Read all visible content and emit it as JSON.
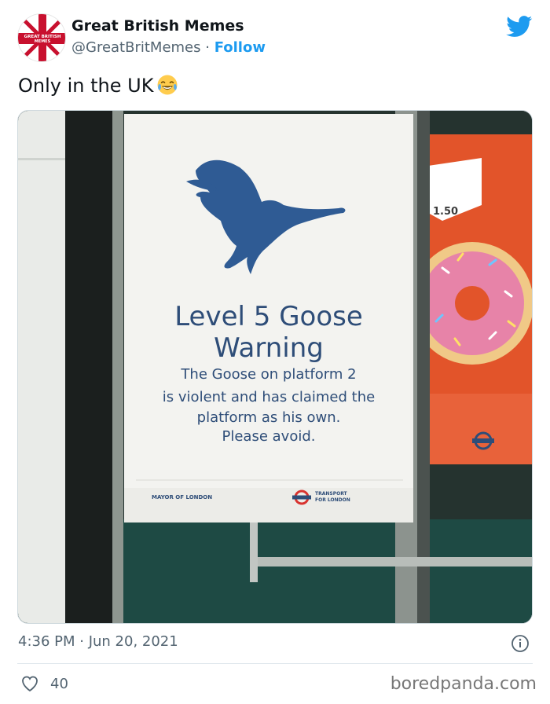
{
  "account": {
    "name": "Great British Memes",
    "handle": "@GreatBritMemes",
    "separator": " · ",
    "follow_label": "Follow",
    "avatar_text_line1": "GREAT BRITISH",
    "avatar_text_line2": "MEMES"
  },
  "tweet": {
    "text": "Only in the UK",
    "emoji": "face-with-tears-of-joy",
    "timestamp": "4:36 PM · Jun 20, 2021",
    "likes": "40"
  },
  "photo": {
    "sign_title_line1": "Level 5 Goose",
    "sign_title_line2": "Warning",
    "sign_body_line1": "The Goose on platform 2",
    "sign_body_line2": "is violent and has claimed the",
    "sign_body_line3": "platform as his own.",
    "sign_body_line4": "Please avoid.",
    "mayor_label": "MAYOR OF LONDON",
    "tfl_label_line1": "TRANSPORT",
    "tfl_label_line2": "FOR LONDON",
    "poster_price": "1.50"
  },
  "watermark": "boredpanda.com",
  "colors": {
    "follow": "#1d9bf0",
    "sign_text": "#2e4d78",
    "goose": "#2f5b94"
  }
}
